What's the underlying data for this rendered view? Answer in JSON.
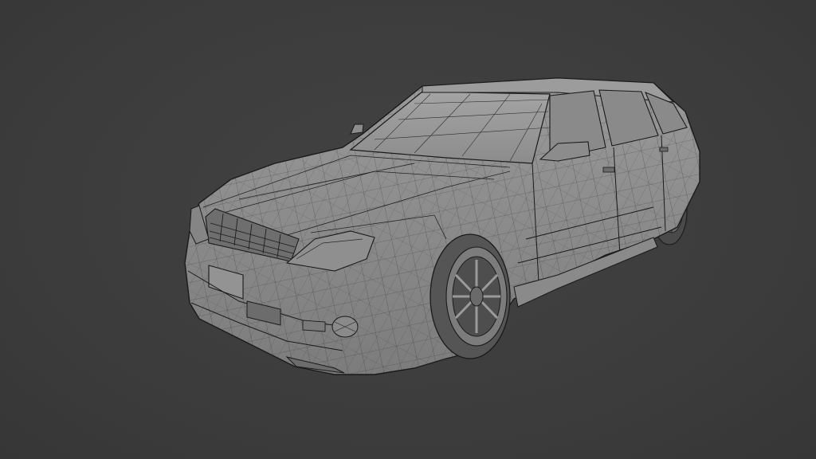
{
  "scene": {
    "background_color": "#3d3d3d",
    "subject": "wireframe-car-model",
    "mesh_color": "#8e8e8e",
    "wire_color": "#1e1e1e",
    "shade_dark": "#5a5a5a"
  }
}
